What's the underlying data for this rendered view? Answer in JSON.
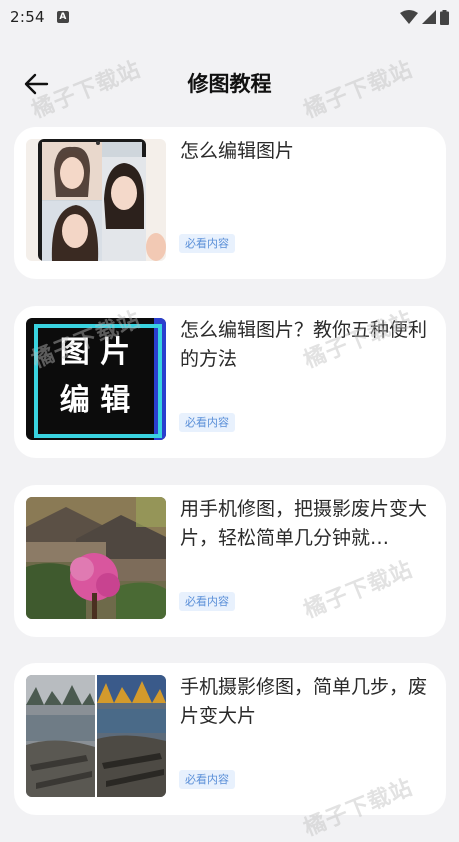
{
  "status_bar": {
    "time": "2:54",
    "notification_badge": "A"
  },
  "header": {
    "title": "修图教程",
    "back_icon": "arrow-left-icon"
  },
  "watermark_text": "橘子下载站",
  "articles": [
    {
      "title": "怎么编辑图片",
      "badge": "必看内容"
    },
    {
      "title": "怎么编辑图片？教你五种便利的方法",
      "badge": "必看内容",
      "thumb_text": [
        "图 片",
        "编 辑"
      ]
    },
    {
      "title": "用手机修图，把摄影废片变大片，轻松简单几分钟就…",
      "badge": "必看内容"
    },
    {
      "title": "手机摄影修图，简单几步，废片变大片",
      "badge": "必看内容"
    }
  ],
  "colors": {
    "background": "#f2f2f4",
    "card": "#ffffff",
    "badge_bg": "#e8f1fd",
    "badge_text": "#5a8fd8"
  }
}
